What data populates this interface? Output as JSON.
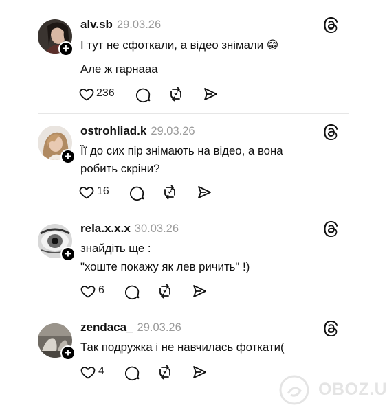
{
  "comments": [
    {
      "username": "alv.sb",
      "date": "29.03.26",
      "lines": [
        "І тут не сфоткали, а відео знімали 😁",
        "Але ж гарнааа"
      ],
      "likes": "236"
    },
    {
      "username": "ostrohliad.k",
      "date": "29.03.26",
      "lines": [
        "Її до сих пір знімають на відео, а вона",
        "робить скріни?"
      ],
      "likes": "16"
    },
    {
      "username": "rela.x.x.x",
      "date": "30.03.26",
      "lines": [
        "знайдіть ще :",
        "\"хоште покажу як лев ричить\" !)"
      ],
      "likes": "6"
    },
    {
      "username": "zendaca_",
      "date": "29.03.26",
      "lines": [
        "Так подружка і не навчилась фоткати("
      ],
      "likes": "4"
    }
  ],
  "watermark": {
    "text": "OBOZ.UA"
  },
  "icons": {
    "threads": "threads-logo-icon",
    "follow": "plus-icon",
    "like": "heart-icon",
    "reply": "comment-icon",
    "repost": "repost-icon",
    "share": "send-icon"
  }
}
